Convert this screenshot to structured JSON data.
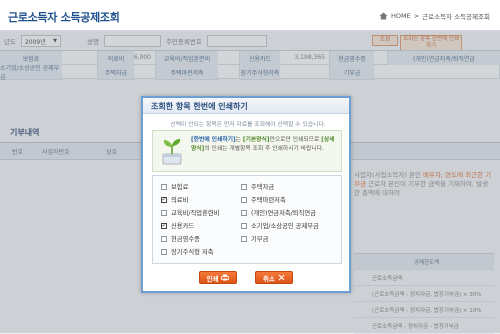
{
  "header": {
    "title": "근로소득자 소득공제조회",
    "breadcrumb_home": "HOME",
    "breadcrumb_sep": ">",
    "breadcrumb_current": "근로소득자 소득공제조회"
  },
  "search": {
    "year_label": "년도",
    "year_value": "2009년",
    "name_label": "성명",
    "id_label": "주민등록번호",
    "query_button": "조회",
    "print_all_button": "조회한 항목 한번에 인쇄하기"
  },
  "grid": {
    "row1": [
      "보험료",
      "의료비",
      "교육비/직업훈련비",
      "신용카드",
      "현금영수증",
      "(개인)연금저축/퇴직연금"
    ],
    "row1_values": [
      "",
      "6,900",
      "",
      "3,198,365",
      "",
      ""
    ],
    "row2": [
      "소기업/소상공인 공제부금",
      "주택자금",
      "주택마련저축",
      "장기주식형저축",
      "기부금",
      ""
    ],
    "section_title": "기부내역",
    "table_headers": [
      "번호",
      "사업자번호",
      "상호"
    ]
  },
  "right_panel": {
    "note_line1": "사업자(사업소득자) 본인",
    "note_highlight": "배우자, 연도에 최근한 기부금",
    "note_rest": "근로자 본인이 기부한 금액을 기재하며, 발생한 총액에 대하여",
    "calc_header": "공제한도액",
    "calc_rows": [
      "근로소득금액",
      "(근로소득금액 - 정치자금, 법정기부금) × 30%",
      "(근로소득금액 - 정치자금, 법정기부금) × 10%",
      "근로소득금액 - 정치자금 - 법정기부금"
    ]
  },
  "modal": {
    "title": "조회한 항목 한번에 인쇄하기",
    "subtitle": "선택이 안되는 항목은 먼저 자료를 조회해야 선택할 수 있습니다.",
    "info_part1": "[한번에 인쇄하기]",
    "info_part2": "는 ",
    "info_part3": "[기본양식]",
    "info_part4": "만으로만 인쇄되므로 ",
    "info_part5": "[상세양식]",
    "info_part6": "의 인쇄는 개별항목 조회 후 인쇄하시기 바랍니다.",
    "options": [
      {
        "label": "보험료",
        "checked": false
      },
      {
        "label": "의료비",
        "checked": true
      },
      {
        "label": "교육비/직업훈련비",
        "checked": false
      },
      {
        "label": "신용카드",
        "checked": true
      },
      {
        "label": "현금영수증",
        "checked": false
      },
      {
        "label": "장기주식형 저축",
        "checked": false
      },
      {
        "label": "주택자금",
        "checked": false
      },
      {
        "label": "주택마련저축",
        "checked": false
      },
      {
        "label": "(개인)연금저축/퇴직연금",
        "checked": false
      },
      {
        "label": "소기업/소상공인 공제부금",
        "checked": false
      },
      {
        "label": "기부금",
        "checked": false
      }
    ],
    "print_button": "인쇄",
    "cancel_button": "취소"
  },
  "colors": {
    "title_blue": "#1d4f8c",
    "accent_orange": "#e8601f",
    "modal_border": "#6d9fd3"
  }
}
